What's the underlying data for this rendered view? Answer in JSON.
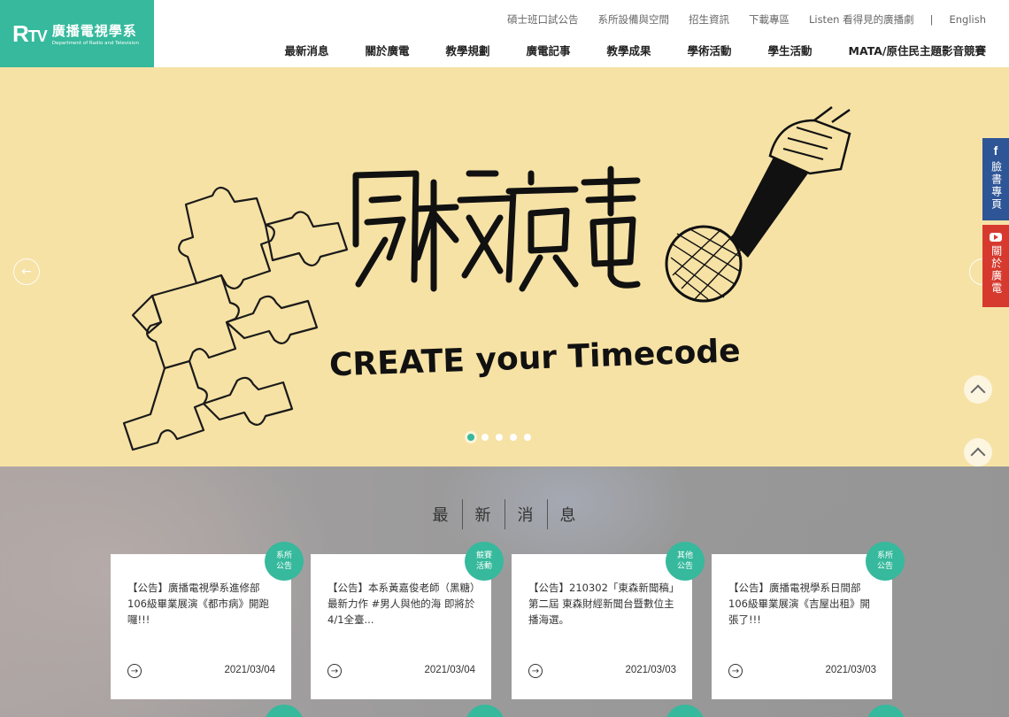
{
  "logo": {
    "mark": "R",
    "mark_tv": "TV",
    "name_zh": "廣播電視學系",
    "name_en": "Department of Radio and Television"
  },
  "top_nav": [
    "碩士班口試公告",
    "系所設備與空間",
    "招生資訊",
    "下載專區",
    "Listen 看得見的廣播劇"
  ],
  "top_nav_separator": "|",
  "language_link": "English",
  "main_nav": [
    "最新消息",
    "關於廣電",
    "教學規劃",
    "廣電記事",
    "教學成果",
    "學術活動",
    "學生活動",
    "MATA/原住民主題影音競賽"
  ],
  "banner": {
    "title_art": "窺校廣電",
    "subtitle_art": "CREATE your Timecode",
    "slides": 5,
    "active_slide": 1
  },
  "side_links": {
    "facebook_icon": "f",
    "facebook_label": "臉書專頁",
    "youtube_label": "關於廣電"
  },
  "news": {
    "title_chars": [
      "最",
      "新",
      "消",
      "息"
    ],
    "cards": [
      {
        "badge": [
          "系所",
          "公告"
        ],
        "text": "【公告】廣播電視學系進修部106級畢業展演《都市病》開跑囉!!!",
        "date": "2021/03/04"
      },
      {
        "badge": [
          "競賽",
          "活動"
        ],
        "text": "【公告】本系黃嘉俊老師（黑糖）最新力作 #男人與他的海 即將於4/1全臺...",
        "date": "2021/03/04"
      },
      {
        "badge": [
          "其他",
          "公告"
        ],
        "text": "【公告】210302「東森新聞稿」第二屆 東森財經新聞台暨數位主播海選。",
        "date": "2021/03/03"
      },
      {
        "badge": [
          "系所",
          "公告"
        ],
        "text": "【公告】廣播電視學系日間部106級畢業展演《吉屋出租》開張了!!!",
        "date": "2021/03/03"
      }
    ],
    "go_glyph": "→"
  },
  "colors": {
    "brand": "#36b99c",
    "banner_bg": "#f6e2a5",
    "facebook": "#2e5596",
    "youtube": "#d63a2e"
  }
}
